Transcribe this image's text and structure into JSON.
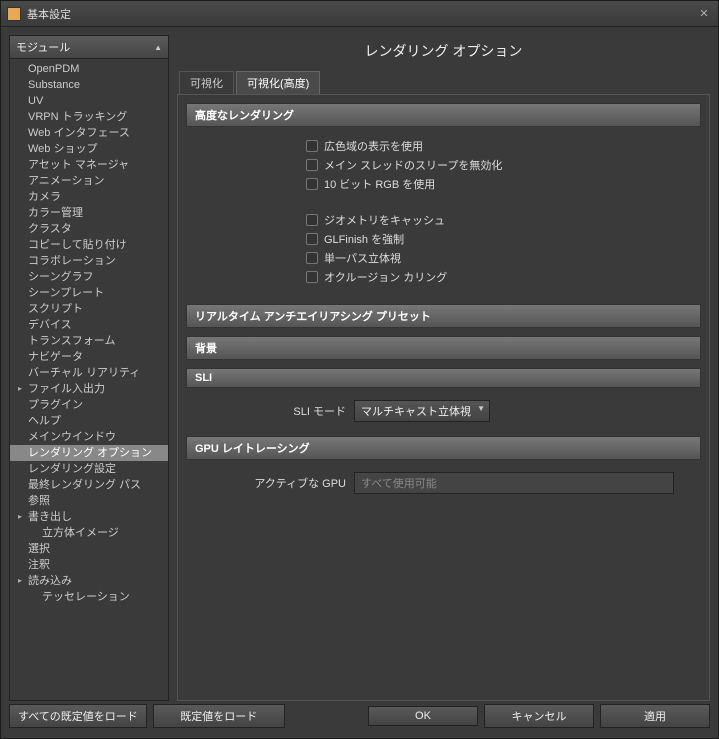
{
  "window": {
    "title": "基本設定"
  },
  "sidebar": {
    "header": "モジュール",
    "items": [
      {
        "label": "OpenPDM"
      },
      {
        "label": "Substance"
      },
      {
        "label": "UV"
      },
      {
        "label": "VRPN トラッキング"
      },
      {
        "label": "Web インタフェース"
      },
      {
        "label": "Web ショップ"
      },
      {
        "label": "アセット マネージャ"
      },
      {
        "label": "アニメーション"
      },
      {
        "label": "カメラ"
      },
      {
        "label": "カラー管理"
      },
      {
        "label": "クラスタ"
      },
      {
        "label": "コピーして貼り付け"
      },
      {
        "label": "コラボレーション"
      },
      {
        "label": "シーングラフ"
      },
      {
        "label": "シーンプレート"
      },
      {
        "label": "スクリプト"
      },
      {
        "label": "デバイス"
      },
      {
        "label": "トランスフォーム"
      },
      {
        "label": "ナビゲータ"
      },
      {
        "label": "バーチャル リアリティ"
      },
      {
        "label": "ファイル入出力",
        "expandable": true
      },
      {
        "label": "プラグイン"
      },
      {
        "label": "ヘルプ"
      },
      {
        "label": "メインウインドウ"
      },
      {
        "label": "レンダリング オプション",
        "selected": true
      },
      {
        "label": "レンダリング設定"
      },
      {
        "label": "最終レンダリング パス"
      },
      {
        "label": "参照"
      },
      {
        "label": "書き出し",
        "expandable": true
      },
      {
        "label": "立方体イメージ",
        "sub": true
      },
      {
        "label": "選択"
      },
      {
        "label": "注釈"
      },
      {
        "label": "読み込み",
        "expandable": true
      },
      {
        "label": "テッセレーション",
        "sub": true
      }
    ]
  },
  "main": {
    "title": "レンダリング オプション",
    "tabs": [
      {
        "label": "可視化"
      },
      {
        "label": "可視化(高度)",
        "active": true
      }
    ],
    "sections": {
      "advanced": {
        "title": "高度なレンダリング",
        "checks": [
          "広色域の表示を使用",
          "メイン スレッドのスリープを無効化",
          "10 ビット RGB を使用"
        ],
        "checks2": [
          "ジオメトリをキャッシュ",
          "GLFinish を強制",
          "単一パス立体視",
          "オクルージョン カリング"
        ]
      },
      "aa": {
        "title": "リアルタイム アンチエイリアシング プリセット"
      },
      "bg": {
        "title": "背景"
      },
      "sli": {
        "title": "SLI",
        "mode_label": "SLI モード",
        "mode_value": "マルチキャスト立体視"
      },
      "gpu": {
        "title": "GPU レイトレーシング",
        "active_label": "アクティブな GPU",
        "active_placeholder": "すべて使用可能"
      }
    }
  },
  "footer": {
    "load_all": "すべての既定値をロード",
    "load": "既定値をロード",
    "ok": "OK",
    "cancel": "キャンセル",
    "apply": "適用"
  }
}
